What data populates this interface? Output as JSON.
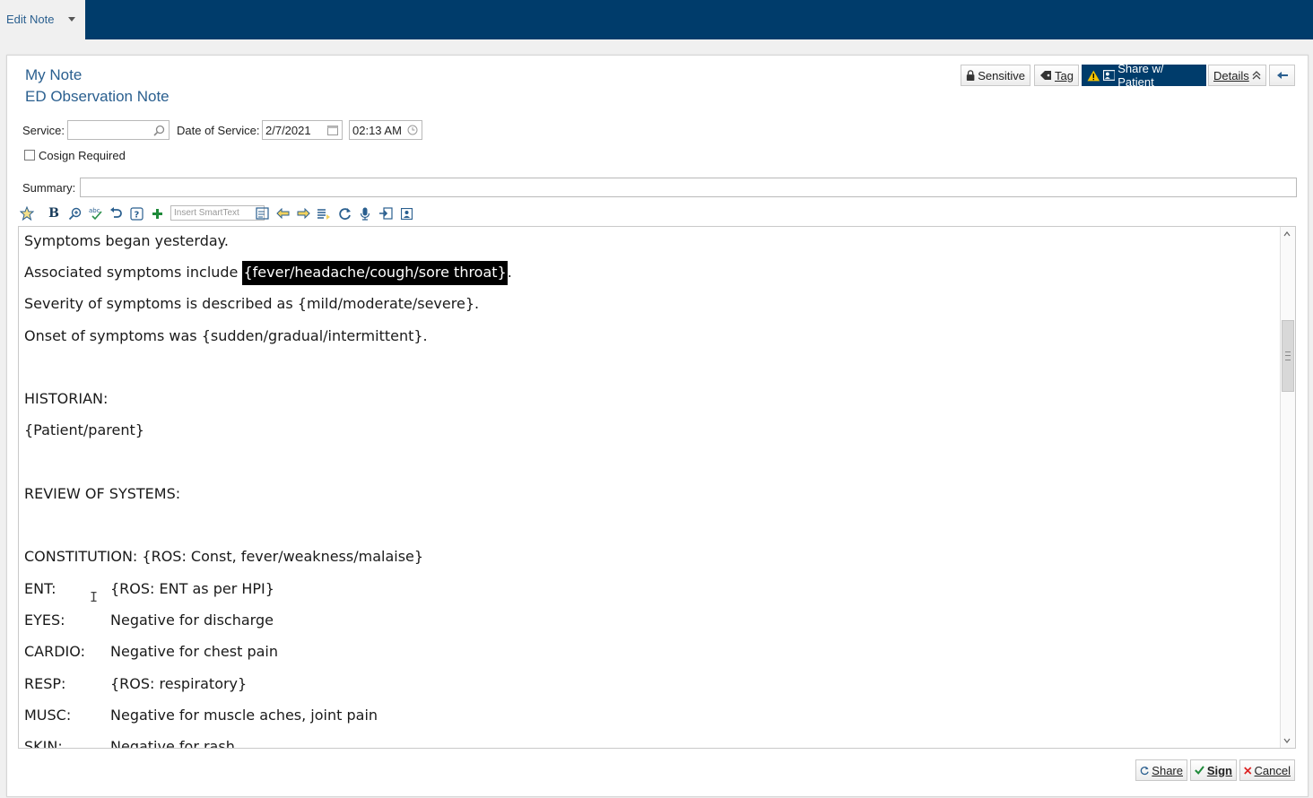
{
  "app": {
    "tab_label": "Edit Note"
  },
  "note": {
    "title": "My Note",
    "type": "ED Observation Note"
  },
  "header_buttons": {
    "sensitive": "Sensitive",
    "tag": "Tag",
    "share_patient": "Share w/ Patient",
    "details": "Details"
  },
  "form": {
    "service_label": "Service:",
    "service_value": "",
    "date_label": "Date of Service:",
    "date_value": "2/7/2021",
    "time_value": "02:13 AM",
    "cosign_label": "Cosign Required",
    "summary_label": "Summary:",
    "summary_value": ""
  },
  "toolbar": {
    "smarttext_placeholder": "Insert SmartText"
  },
  "editor": {
    "line1": "Symptoms began yesterday.",
    "line2_prefix": "Associated symptoms include ",
    "line2_highlight": "{fever/headache/cough/sore throat}",
    "line2_suffix": ".",
    "line3": "Severity of symptoms is described as {mild/moderate/severe}.",
    "line4": "Onset of symptoms was {sudden/gradual/intermittent}.",
    "historian_heading": "HISTORIAN:",
    "historian_value": "{Patient/parent}",
    "ros_heading": "REVIEW OF SYSTEMS:",
    "constitution": "CONSTITUTION:   {ROS: Const, fever/weakness/malaise}",
    "ros_rows": [
      {
        "label": "ENT:",
        "value": "{ROS: ENT as per HPI}"
      },
      {
        "label": "EYES:",
        "value": "Negative for discharge"
      },
      {
        "label": "CARDIO:",
        "value": "Negative for chest pain"
      },
      {
        "label": "RESP:",
        "value": "{ROS: respiratory}"
      },
      {
        "label": "MUSC:",
        "value": "Negative for muscle aches, joint pain"
      },
      {
        "label": "SKIN:",
        "value": "Negative for rash"
      }
    ]
  },
  "footer_buttons": {
    "share": "Share",
    "sign": "Sign",
    "cancel": "Cancel"
  },
  "colors": {
    "topbar": "#003c6b",
    "accent_text": "#2a5f8f",
    "warning": "#f5c400"
  }
}
